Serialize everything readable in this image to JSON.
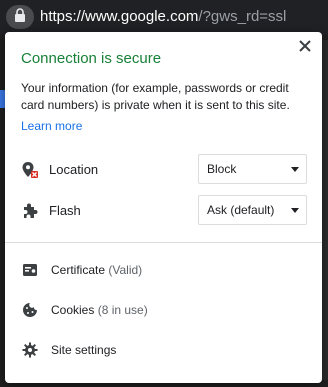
{
  "urlbar": {
    "host": "https://www.google.com",
    "path": "/?gws_rd=ssl"
  },
  "popup": {
    "title": "Connection is secure",
    "description": "Your information (for example, passwords or credit card numbers) is private when it is sent to this site.",
    "learn_more": "Learn more",
    "permissions": [
      {
        "label": "Location",
        "value": "Block",
        "icon": "location-blocked-icon"
      },
      {
        "label": "Flash",
        "value": "Ask (default)",
        "icon": "puzzle-piece-icon"
      }
    ],
    "links": [
      {
        "label": "Certificate",
        "detail": "(Valid)",
        "icon": "certificate-icon"
      },
      {
        "label": "Cookies",
        "detail": "(8 in use)",
        "icon": "cookie-icon"
      },
      {
        "label": "Site settings",
        "detail": "",
        "icon": "gear-icon"
      }
    ]
  },
  "colors": {
    "secure_green": "#188038",
    "link_blue": "#1a73e8",
    "toolbar_bg": "#202124"
  }
}
